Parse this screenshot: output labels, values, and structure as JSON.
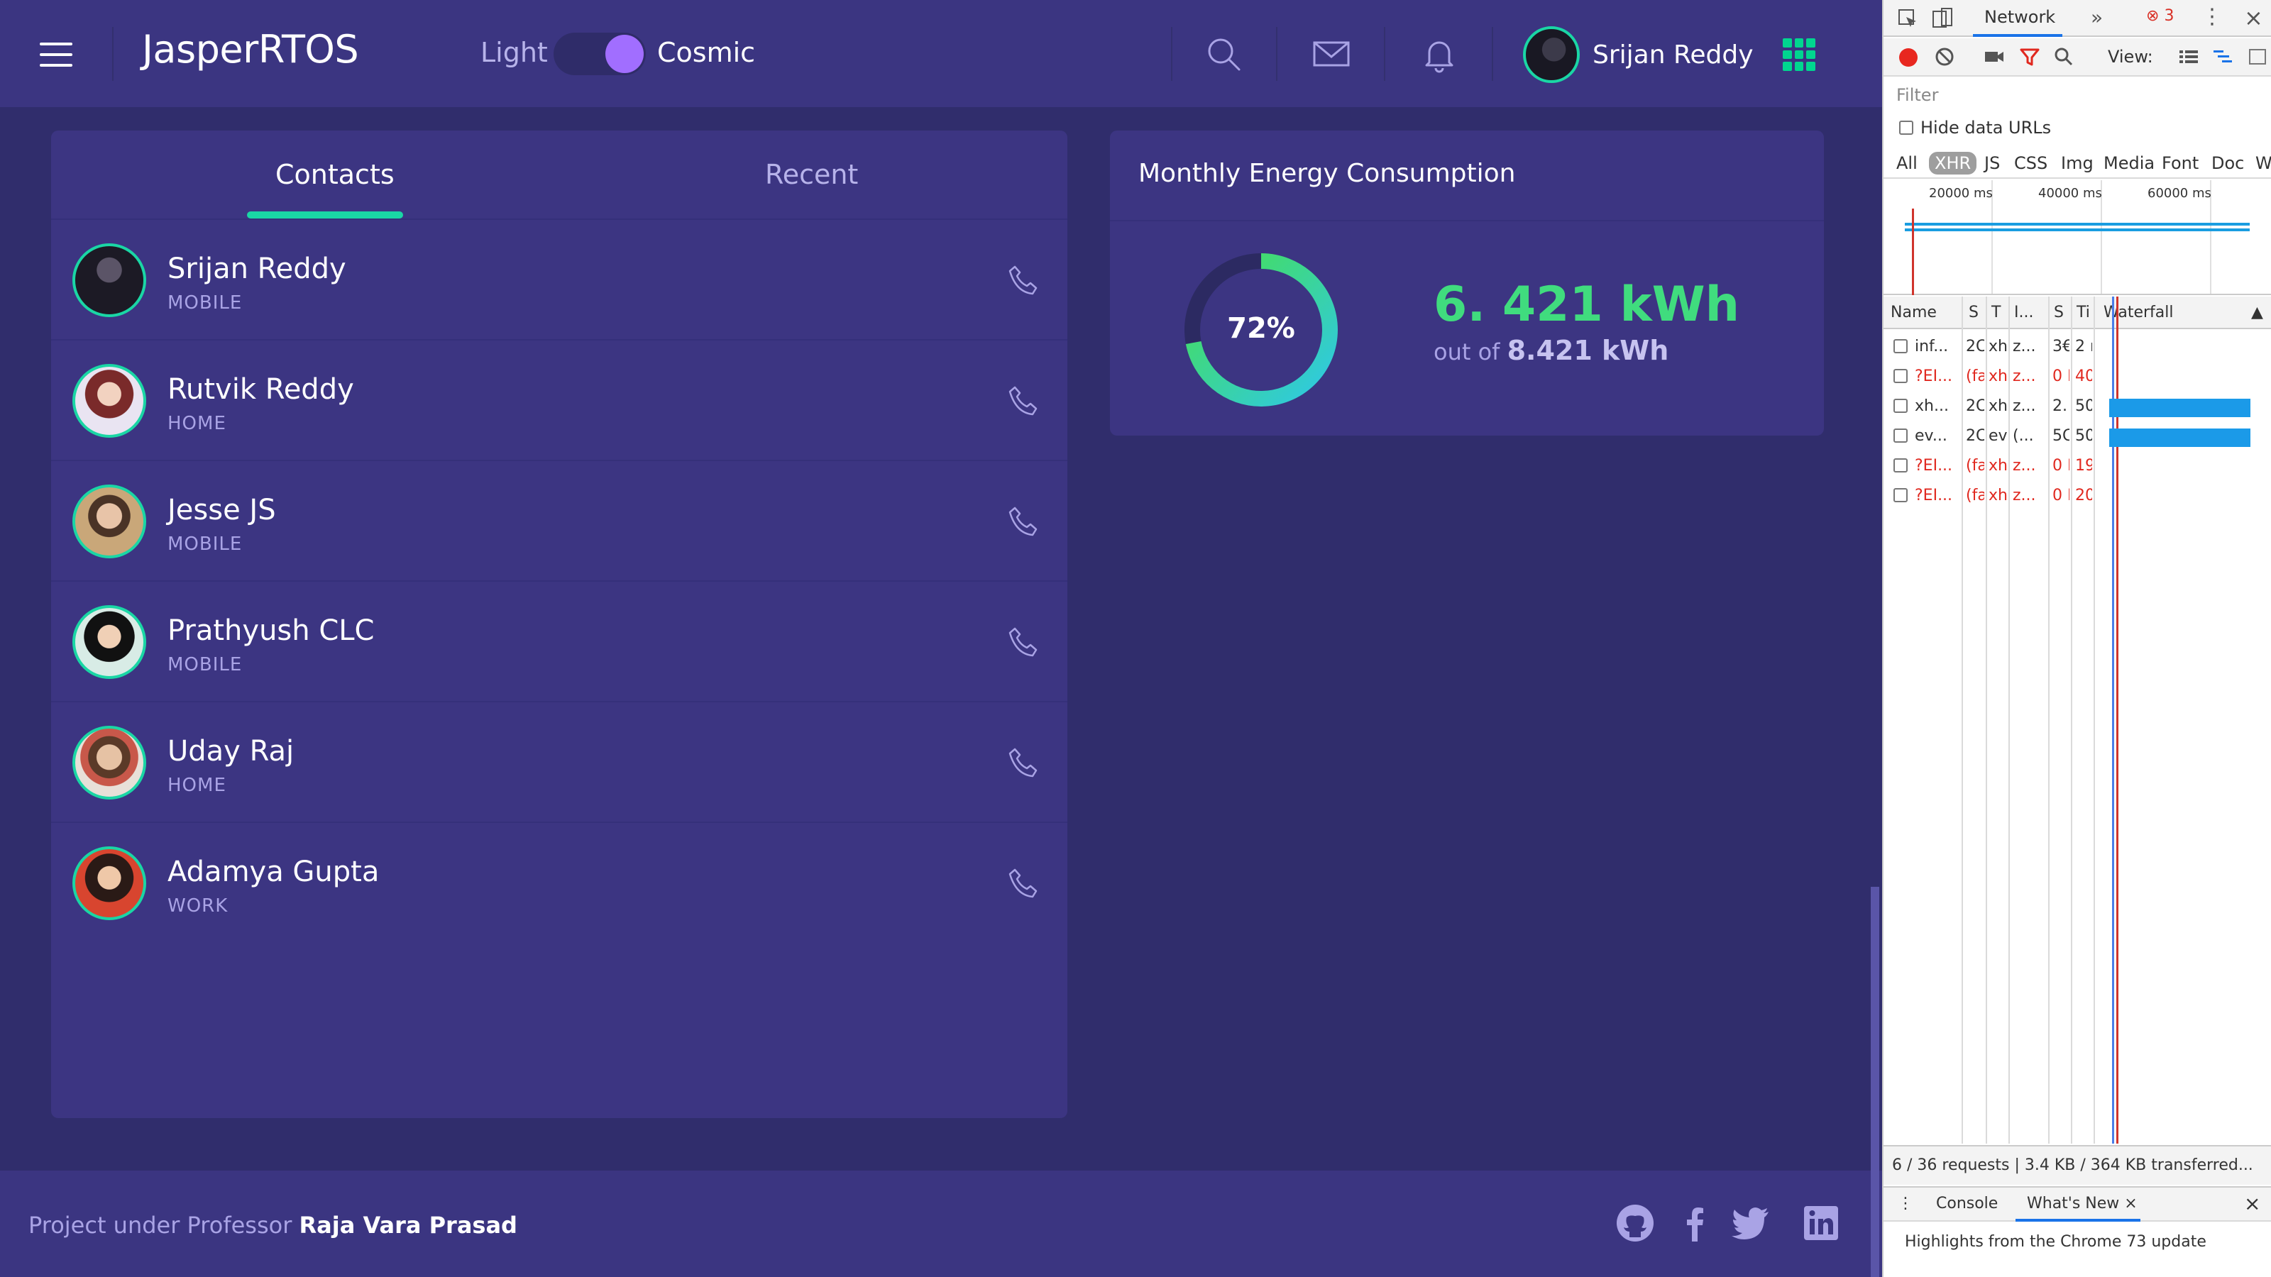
{
  "header": {
    "logo": "JasperRTOS",
    "theme_light": "Light",
    "theme_cosmic": "Cosmic",
    "user_name": "Srijan Reddy"
  },
  "contacts": {
    "tab_contacts": "Contacts",
    "tab_recent": "Recent",
    "items": [
      {
        "name": "Srijan Reddy",
        "type": "MOBILE"
      },
      {
        "name": "Rutvik Reddy",
        "type": "HOME"
      },
      {
        "name": "Jesse JS",
        "type": "MOBILE"
      },
      {
        "name": "Prathyush CLC",
        "type": "MOBILE"
      },
      {
        "name": "Uday Raj",
        "type": "HOME"
      },
      {
        "name": "Adamya Gupta",
        "type": "WORK"
      }
    ]
  },
  "energy": {
    "title": "Monthly Energy Consumption",
    "percent_label": "72%",
    "percent_value": 0.72,
    "value": "6. 421 kWh",
    "out_of_prefix": "out of",
    "out_of_value": "8.421 kWh"
  },
  "footer": {
    "text_prefix": "Project under Professor",
    "professor": "Raja Vara Prasad"
  },
  "devtools": {
    "tab_network": "Network",
    "error_count": "3",
    "view_label": "View:",
    "filter_placeholder": "Filter",
    "hide_data_urls": "Hide data URLs",
    "types": [
      "All",
      "XHR",
      "JS",
      "CSS",
      "Img",
      "Media",
      "Font",
      "Doc",
      "W"
    ],
    "active_type": "XHR",
    "overview_labels": [
      "20000 ms",
      "40000 ms",
      "60000 ms"
    ],
    "columns": [
      "Name",
      "S",
      "T",
      "I...",
      "S",
      "Ti",
      "Waterfall"
    ],
    "rows": [
      {
        "name": "inf...",
        "status": "2C",
        "type": "xh",
        "init": "z...",
        "size": "3€",
        "time": "2 r",
        "error": false,
        "waterfall_start": 0.0,
        "waterfall_len": 0.0
      },
      {
        "name": "?EI...",
        "status": "(fa",
        "type": "xh",
        "init": "z...",
        "size": "0 I",
        "time": "40",
        "error": true,
        "waterfall_start": 0.0,
        "waterfall_len": 0.0
      },
      {
        "name": "xh...",
        "status": "2C",
        "type": "xh",
        "init": "z...",
        "size": "2.",
        "time": "50",
        "error": false,
        "waterfall_start": 0.05,
        "waterfall_len": 0.83
      },
      {
        "name": "ev...",
        "status": "2C",
        "type": "ev",
        "init": "(...",
        "size": "5C",
        "time": "50",
        "error": false,
        "waterfall_start": 0.05,
        "waterfall_len": 0.83
      },
      {
        "name": "?EI...",
        "status": "(fa",
        "type": "xh",
        "init": "z...",
        "size": "0 I",
        "time": "19",
        "error": true,
        "waterfall_start": 0.0,
        "waterfall_len": 0.0
      },
      {
        "name": "?EI...",
        "status": "(fa",
        "type": "xh",
        "init": "z...",
        "size": "0 I",
        "time": "20",
        "error": true,
        "waterfall_start": 0.0,
        "waterfall_len": 0.0
      }
    ],
    "status_bar": "6 / 36 requests  |  3.4 KB / 364 KB transferred...",
    "drawer_tabs": [
      "Console",
      "What's New"
    ],
    "drawer_text": "Highlights from the Chrome 73 update"
  }
}
